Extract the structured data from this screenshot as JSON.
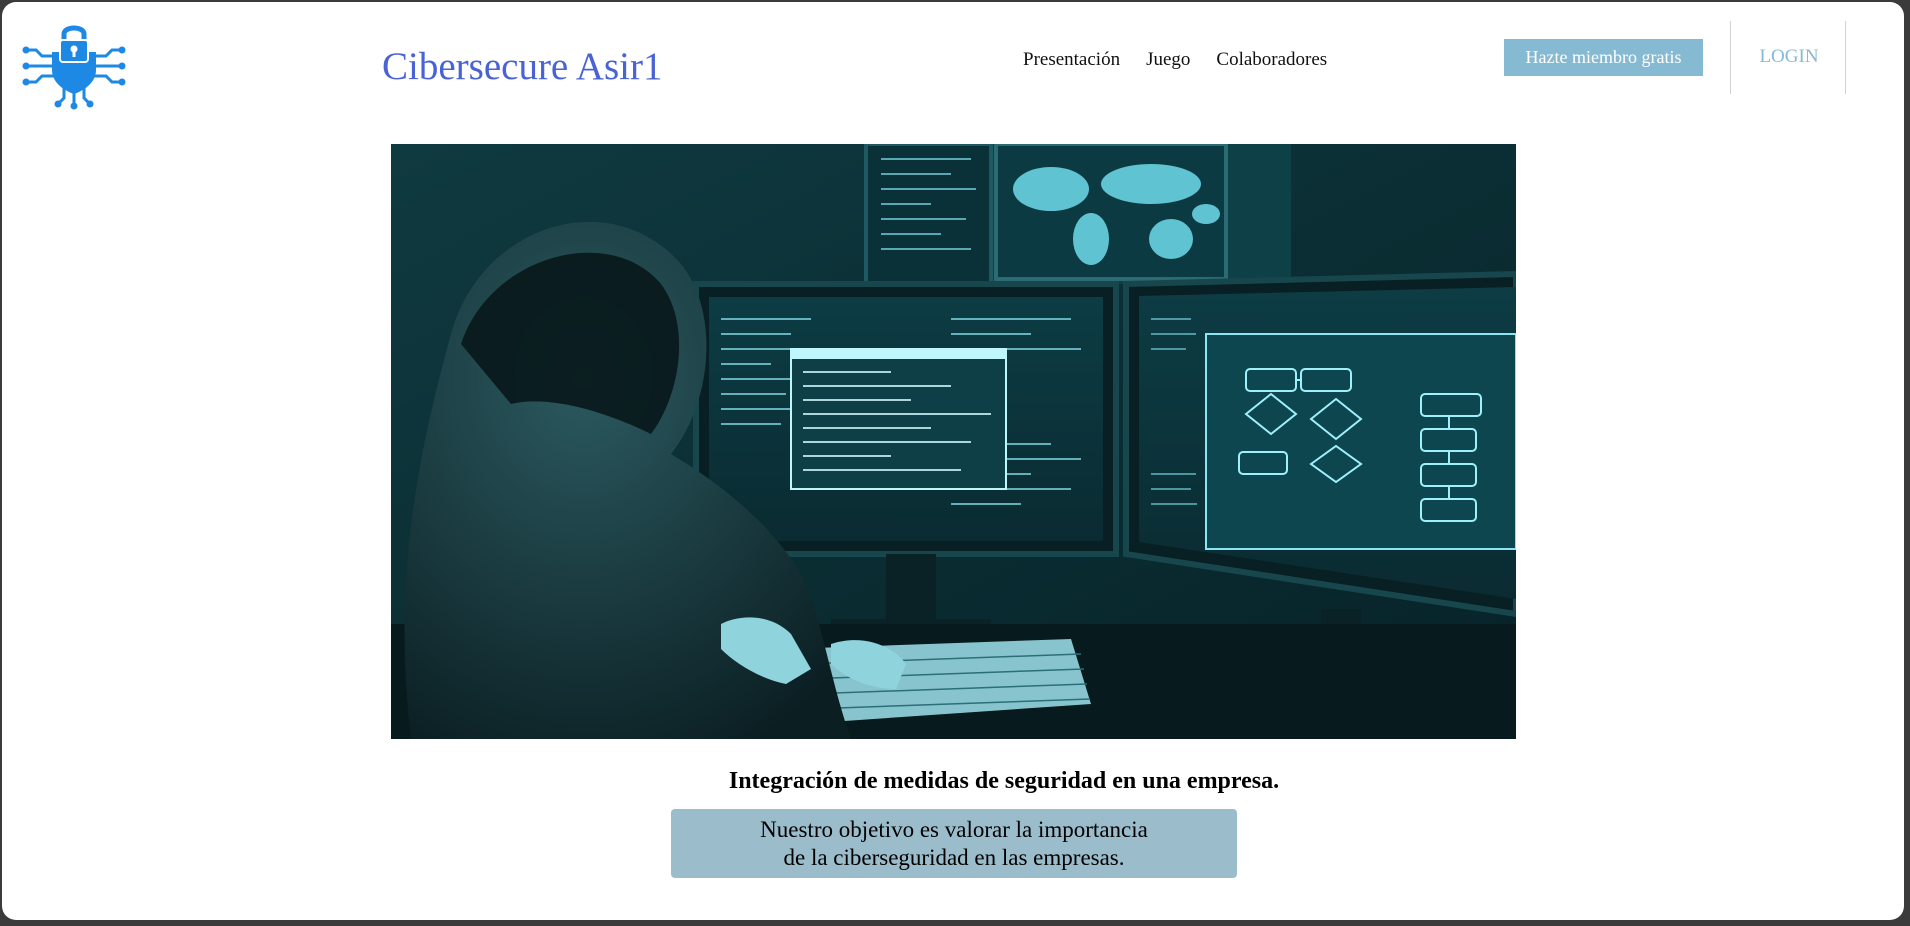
{
  "header": {
    "logo_icon": "shield-padlock-circuit-icon",
    "site_title": "Cibersecure Asir1",
    "nav": [
      {
        "label": "Presentación"
      },
      {
        "label": "Juego"
      },
      {
        "label": "Colaboradores"
      }
    ],
    "join_button_label": "Hazte miembro gratis",
    "login_label": "LOGIN"
  },
  "hero": {
    "image_subject": "hooded-hacker-at-multiple-monitors"
  },
  "content": {
    "headline": "Integración de medidas de seguridad en una empresa.",
    "objective_line1": "Nuestro objetivo es valorar la importancia",
    "objective_line2": "de la ciberseguridad en las empresas."
  },
  "colors": {
    "title": "#4a63d4",
    "accent": "#86b9d2",
    "objective_box": "#9bbccb",
    "logo_blue": "#1e88e5"
  }
}
